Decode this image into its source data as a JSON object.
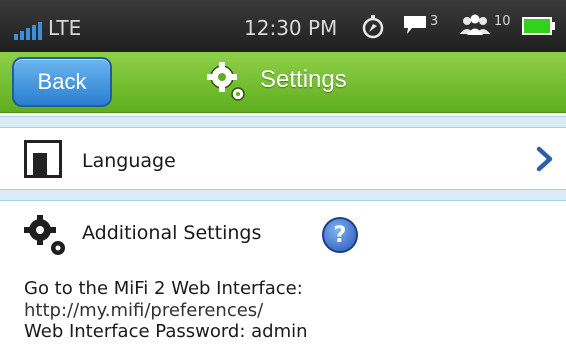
{
  "status": {
    "network": "LTE",
    "time": "12:30 PM",
    "messages": "3",
    "devices": "10"
  },
  "header": {
    "back": "Back",
    "title": "Settings"
  },
  "language": {
    "label": "Language"
  },
  "additional": {
    "label": "Additional Settings",
    "help": "?"
  },
  "info": {
    "heading": "Go to the MiFi 2 Web Interface:",
    "url": "http://my.mifi/preferences/",
    "password_label": "Web Interface Password:",
    "password_value": "admin"
  },
  "colors": {
    "header_green": "#6fbc2c",
    "back_blue": "#2c7fcf",
    "accent_blue": "#2d5fa8",
    "battery_green": "#32d11b"
  }
}
